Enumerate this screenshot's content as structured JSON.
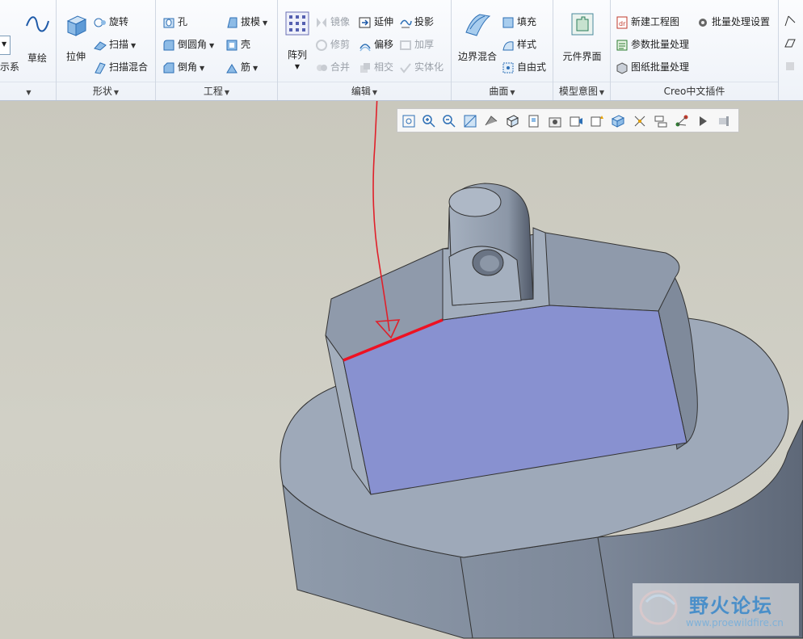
{
  "ribbon": {
    "datum_group": {
      "coord_label": "示系",
      "sketch_label": "草绘"
    },
    "shape_group": {
      "label": "形状",
      "extrude": "拉伸",
      "revolve": "旋转",
      "sweep": "扫描",
      "swept_blend": "扫描混合"
    },
    "engineering_group": {
      "label": "工程",
      "hole": "孔",
      "round": "倒圆角",
      "chamfer": "倒角",
      "draft": "拔模",
      "shell": "壳",
      "rib": "筋"
    },
    "editing_group": {
      "label": "编辑",
      "pattern": "阵列",
      "mirror": "镜像",
      "trim": "修剪",
      "merge": "合并",
      "extend": "延伸",
      "offset": "偏移",
      "intersect": "相交",
      "project": "投影",
      "thicken": "加厚",
      "solidify": "实体化"
    },
    "surface_group": {
      "label": "曲面",
      "boundary_blend": "边界混合",
      "fill": "填充",
      "style": "样式",
      "freestyle": "自由式"
    },
    "model_intent_group": {
      "label": "模型意图",
      "component_interface": "元件界面"
    },
    "creo_plugin_group": {
      "label": "Creo中文插件",
      "new_drawing": "新建工程图",
      "param_batch": "参数批量处理",
      "drawing_batch": "图纸批量处理",
      "batch_settings": "批量处理设置"
    }
  },
  "watermark": {
    "title": "野火论坛",
    "url": "www.proewildfire.cn"
  },
  "colors": {
    "selected_face": "#8891d0",
    "highlight_edge": "#ee1122",
    "annotation": "#e0202a",
    "model_gray": "#9aa6b6",
    "background": "#cccbc1"
  }
}
